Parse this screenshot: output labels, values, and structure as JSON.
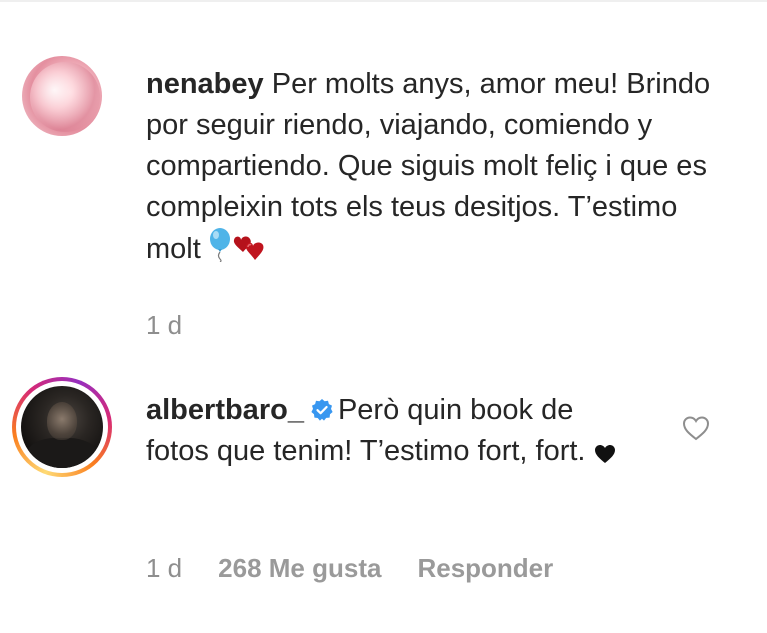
{
  "comments": [
    {
      "username": "nenabey",
      "text": "Per molts anys, amor meu! Brindo por seguir riendo, viajando, comiendo y compartiendo. Que siguis molt feliç i que es compleixin tots els teus desitjos. T’estimo molt",
      "emojis": [
        "balloon-icon",
        "two-hearts-icon"
      ],
      "time": "1 d",
      "avatar_icon": "avatar-nenabey",
      "verified": false
    },
    {
      "username": "albertbaro_",
      "text": "Però quin book de fotos que tenim! T’estimo fort, fort.",
      "emojis": [
        "black-heart-icon"
      ],
      "time": "1 d",
      "likes": "268 Me gusta",
      "reply": "Responder",
      "avatar_icon": "avatar-albertbaro",
      "verified": true,
      "like_icon": "heart-outline-icon"
    }
  ],
  "colors": {
    "text": "#262626",
    "meta": "#8e8e8e",
    "verified": "#3897f0",
    "balloon": "#4fb4e8",
    "heart_red": "#c0141e"
  }
}
